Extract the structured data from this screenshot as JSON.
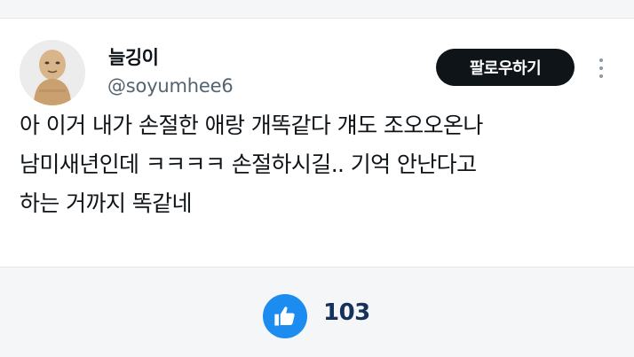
{
  "post": {
    "author": {
      "display_name": "늘깅이",
      "handle": "@soyumhee6",
      "avatar_icon": "avatar-face-icon"
    },
    "follow_button_label": "팔로우하기",
    "more_icon": "more-vertical-icon",
    "text_lines": [
      "아 이거 내가 손절한 애랑 개똑같다 걔도 조오오온나",
      "남미새년인데 ㅋㅋㅋㅋ 손절하시길.. 기억 안난다고",
      "하는 거까지 똑같네"
    ]
  },
  "reactions": {
    "like_icon": "thumbs-up-icon",
    "like_count": "103"
  },
  "colors": {
    "follow_button_bg": "#0f1419",
    "like_button_bg": "#1d8cf0",
    "like_count_text": "#16325c",
    "handle_text": "#536471"
  }
}
